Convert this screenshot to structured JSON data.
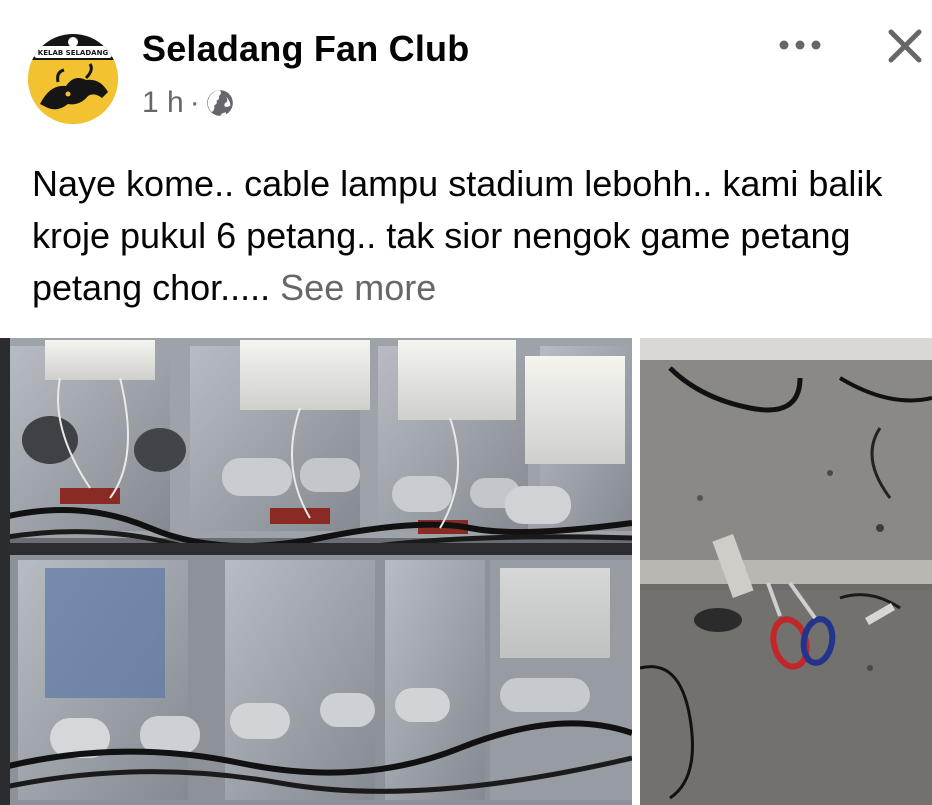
{
  "post": {
    "page_name": "Seladang Fan Club",
    "time": "1 h",
    "separator": "·",
    "privacy_icon": "globe-icon",
    "avatar": {
      "ring_text": "KELAB SELADANG",
      "colors": {
        "primary": "#f2c230",
        "dark": "#151515"
      }
    },
    "body": "Naye kome.. cable lampu stadium lebohh.. kami balik kroje pukul 6 petang.. tak sior nengok game petang petang chor.....",
    "see_more": "See more"
  },
  "actions": {
    "more_icon": "more-horizontal-icon",
    "close_icon": "close-icon"
  },
  "photos": [
    {
      "name": "electrical-panel-photo",
      "description_icon": "photo"
    },
    {
      "name": "floor-tools-photo",
      "description_icon": "photo"
    }
  ],
  "colors": {
    "text": "#050505",
    "secondary_text": "#65676b"
  }
}
